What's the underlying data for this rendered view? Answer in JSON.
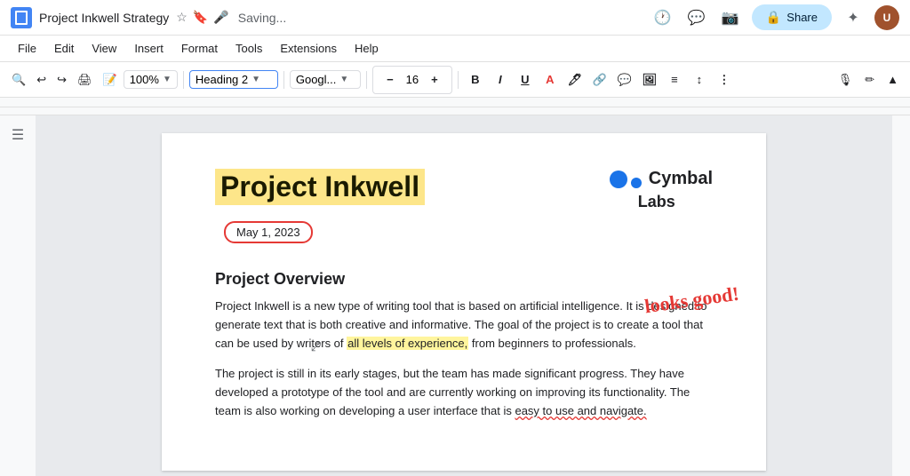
{
  "titleBar": {
    "docTitle": "Project Inkwell Strategy",
    "saving": "Saving...",
    "shareLabel": "Share"
  },
  "menuBar": {
    "items": [
      "File",
      "Edit",
      "View",
      "Insert",
      "Format",
      "Tools",
      "Extensions",
      "Help"
    ]
  },
  "toolbar": {
    "zoom": "100%",
    "heading": "Heading 2",
    "font": "Googl...",
    "fontSize": "16",
    "boldLabel": "B",
    "italicLabel": "I",
    "underlineLabel": "U"
  },
  "document": {
    "mainTitle": "Project Inkwell",
    "date": "May 1, 2023",
    "companyName": "Cymbal",
    "companyNameLine2": "Labs",
    "handwriting": "looks good!",
    "sectionHeading": "Project Overview",
    "paragraph1": "Project Inkwell is a new type of writing tool that is based on artificial intelligence. It is designed to generate text that is both creative and informative. The goal of the project is to create a tool that can be used by writers of ",
    "highlightedText": "all levels of experience,",
    "paragraph1End": " from beginners to professionals.",
    "paragraph2": "The project is still in its early stages, but the team has made significant progress. They have developed a prototype of the tool and are currently working on improving its functionality. The team is also working on developing a user interface that is ",
    "underlinedText": "easy to use and navigate."
  }
}
